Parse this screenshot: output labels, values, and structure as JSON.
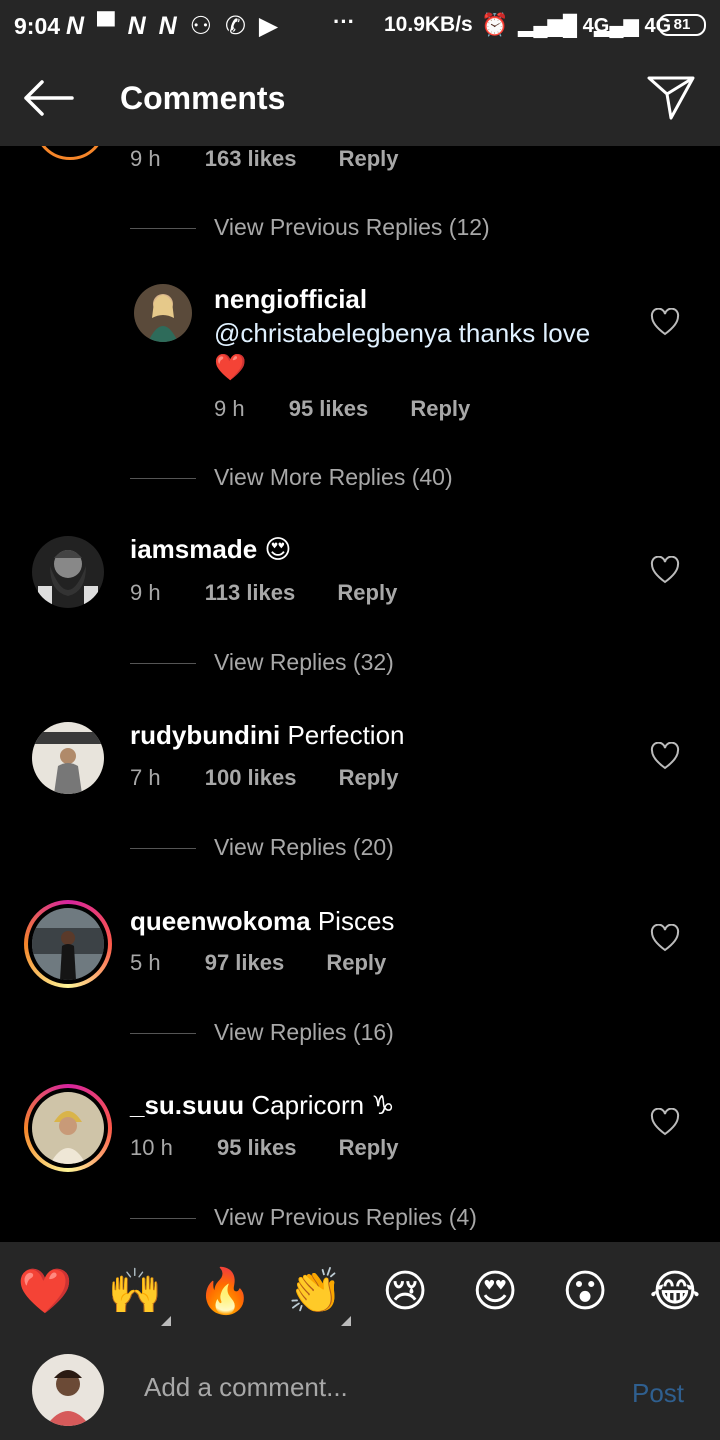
{
  "status_bar": {
    "time": "9:04",
    "notif_icons": "N ▀ N N ⚇ ✆ ▶",
    "dots": "···",
    "speed": "10.9KB/s",
    "network1": "4G",
    "network2": "4G",
    "battery": "81"
  },
  "header": {
    "title": "Comments"
  },
  "comments": [
    {
      "time": "9 h",
      "likes": "163 likes",
      "reply": "Reply",
      "view_replies": "View Previous Replies (12)"
    },
    {
      "username": "nengiofficial",
      "text": "@christabelegbenya thanks love",
      "emoji": "❤️",
      "time": "9 h",
      "likes": "95 likes",
      "reply": "Reply",
      "view_replies": "View More Replies (40)"
    },
    {
      "username": "iamsmade",
      "text": "😍",
      "time": "9 h",
      "likes": "113 likes",
      "reply": "Reply",
      "view_replies": "View Replies (32)"
    },
    {
      "username": "rudybundini",
      "text": "Perfection",
      "time": "7 h",
      "likes": "100 likes",
      "reply": "Reply",
      "view_replies": "View Replies (20)"
    },
    {
      "username": "queenwokoma",
      "text": "Pisces",
      "time": "5 h",
      "likes": "97 likes",
      "reply": "Reply",
      "view_replies": "View Replies (16)"
    },
    {
      "username": "_su.suuu",
      "text": "Capricorn ♑",
      "time": "10 h",
      "likes": "95 likes",
      "reply": "Reply",
      "view_replies": "View Previous Replies (4)"
    }
  ],
  "emoji_bar": [
    "❤️",
    "🙌",
    "🔥",
    "👏",
    "😢",
    "😍",
    "😮",
    "😂"
  ],
  "composer": {
    "placeholder": "Add a comment...",
    "post": "Post"
  },
  "colors": {
    "bar_bg": "#262626",
    "muted": "#a8a8a8",
    "post": "#2f5f8f",
    "ring": "#f58529"
  }
}
